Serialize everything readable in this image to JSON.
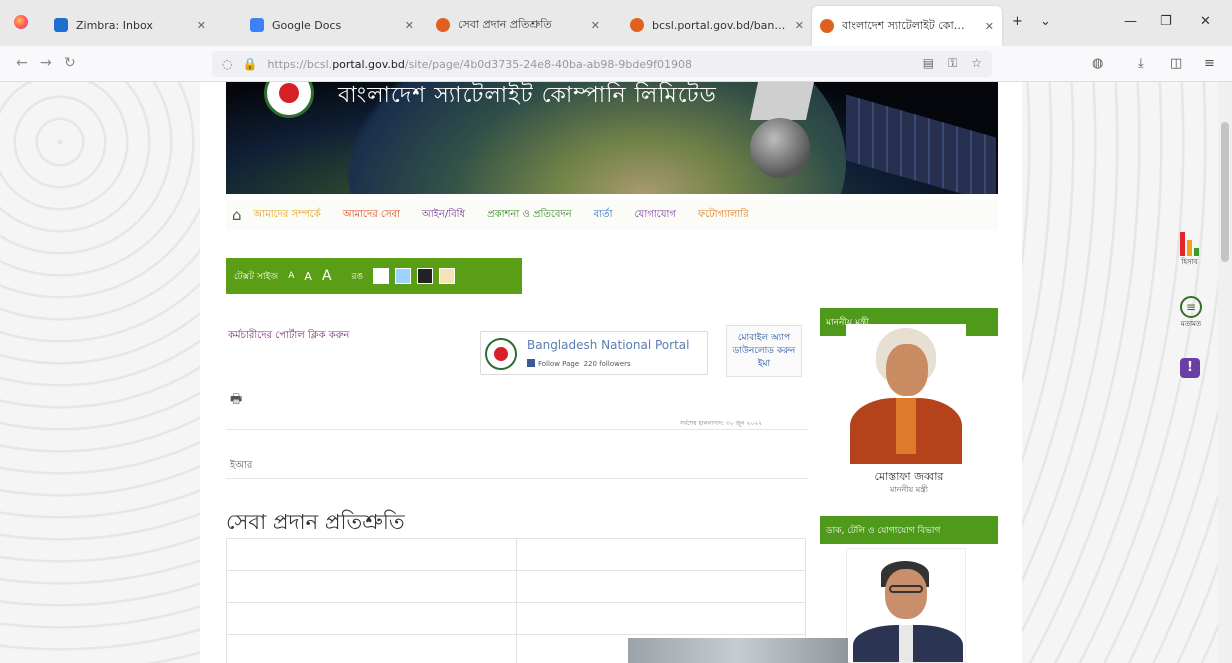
{
  "tabs": [
    {
      "label": "Zimbra: Inbox",
      "favicon_color": "#1f6fd1"
    },
    {
      "label": "Google Docs",
      "favicon_color": "#3b82f6"
    },
    {
      "label": "সেবা প্রদান প্রতিশ্রুতি",
      "favicon_color": "#e0611f"
    },
    {
      "label": "bcsl.portal.gov.bd/bangladesh-",
      "favicon_color": "#e0611f"
    },
    {
      "label": "বাংলাদেশ স্যাটেলাইট কোম্পানি লি",
      "favicon_color": "#e0611f",
      "active": true
    }
  ],
  "url": {
    "prefix": "https://bcsl.",
    "domain": "portal.gov.bd",
    "rest": "/site/page/4b0d3735-24e8-40ba-ab98-9bde9f01908"
  },
  "banner": {
    "title": "বাংলাদেশ স্যাটেলাইট কোম্পানি লিমিটেড"
  },
  "menu": [
    {
      "label": "আমাদের সম্পর্কে",
      "color": "#e0a21a"
    },
    {
      "label": "আমাদের সেবা",
      "color": "#d94a1c"
    },
    {
      "label": "আইন/বিধি",
      "color": "#7a3c9a"
    },
    {
      "label": "প্রকাশনা ও প্রতিবেদন",
      "color": "#3a8a2a"
    },
    {
      "label": "বার্তা",
      "color": "#2a70c4"
    },
    {
      "label": "যোগাযোগ",
      "color": "#7a3c9a"
    },
    {
      "label": "ফটোগ্যালারি",
      "color": "#e07a1a"
    }
  ],
  "a11y": {
    "text_size_label": "টেক্সট সাইজ",
    "minus": "A",
    "normal": "A",
    "plus": "A",
    "color_label": "রঙ",
    "swatches": [
      "#ffffff",
      "#9fd3ff",
      "#222222",
      "#f3e3b8"
    ]
  },
  "control_link": "কর্মচারীদের পোর্টাল ক্লিক করুন",
  "portal": {
    "title": "Bangladesh National Portal",
    "fb": "Follow Page",
    "fb_count": "220 followers"
  },
  "app_box": {
    "l1": "মোবাইল অ্যাপ",
    "l2": "ডাউনলোড করুন",
    "l3": "ইমা"
  },
  "updated": "সর্বশেষ হালনাগাদ: ৩০ জুন ২০২২",
  "ref": "ইআর",
  "heading": "সেবা প্রদান প্রতিশ্রুতি",
  "sidebar": {
    "h1": "মাননীয় মন্ত্রী",
    "person1_name": "মোস্তাফা জব্বার",
    "person1_role": "মাননীয় মন্ত্রী",
    "h2": "ডাক, টেলি ও যোগাযোগ বিভাগ",
    "person2_name": ""
  },
  "side_widgets": {
    "stats": "হিসাব",
    "chat": "মতামত",
    "info": "!"
  }
}
